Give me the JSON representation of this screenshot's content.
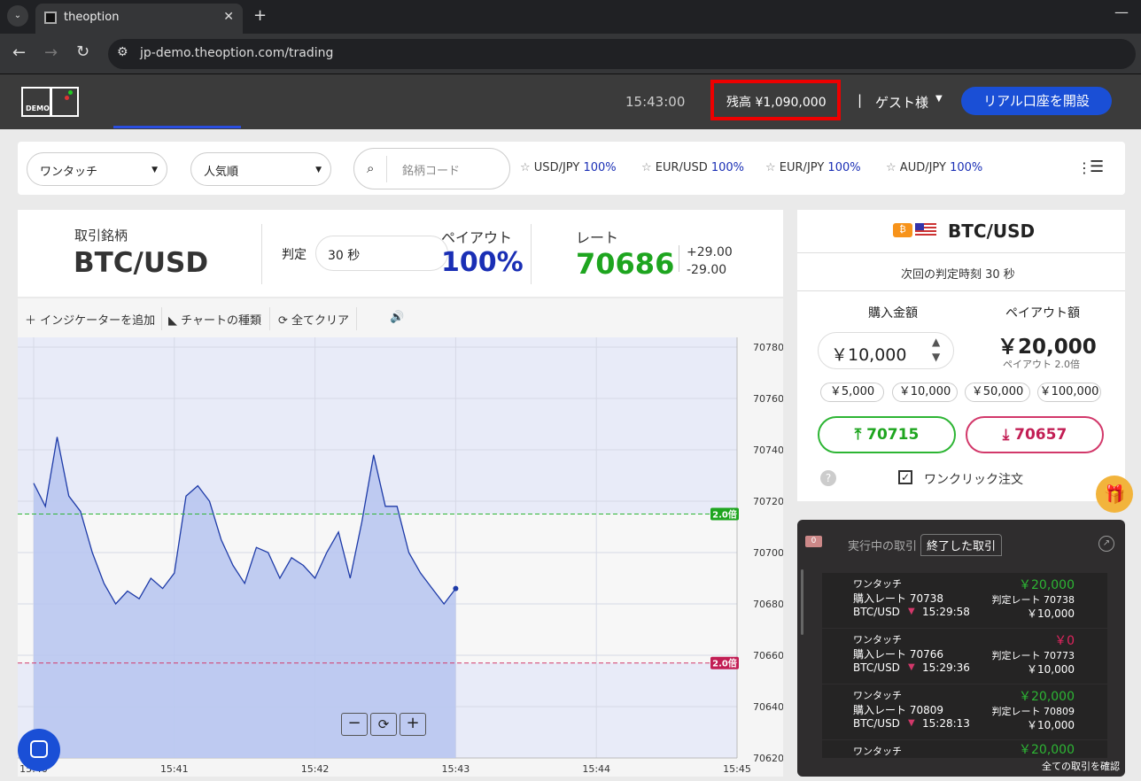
{
  "browser": {
    "tab_title": "theoption",
    "url": "jp-demo.theoption.com/trading"
  },
  "header": {
    "logo_text": "DEMO",
    "time": "15:43:00",
    "balance": "残高 ¥1,090,000",
    "user": "ゲスト様",
    "open_account": "リアル口座を開設"
  },
  "toolbar": {
    "select_type": "ワンタッチ",
    "select_sort": "人気順",
    "search_placeholder": "銘柄コード",
    "favorites": [
      {
        "pair": "USD/JPY",
        "payout": "100%"
      },
      {
        "pair": "EUR/USD",
        "payout": "100%"
      },
      {
        "pair": "EUR/JPY",
        "payout": "100%"
      },
      {
        "pair": "AUD/JPY",
        "payout": "100%"
      }
    ]
  },
  "instrument": {
    "label": "取引銘柄",
    "symbol": "BTC/USD",
    "judge_label": "判定",
    "judge_value": "30 秒",
    "payout_label": "ペイアウト",
    "payout_value": "100%",
    "rate_label": "レート",
    "rate_value": "70686",
    "delta_up": "+29.00",
    "delta_down": "-29.00"
  },
  "chart_tools": {
    "add_indicator": "インジケーターを追加",
    "chart_type": "チャートの種類",
    "clear_all": "全てクリア"
  },
  "chart_data": {
    "type": "area",
    "x_ticks": [
      "15:40",
      "15:41",
      "15:42",
      "15:43",
      "15:44",
      "15:45"
    ],
    "y_ticks": [
      70780,
      70760,
      70740,
      70720,
      70700,
      70680,
      70660,
      70640,
      70620
    ],
    "ylim": [
      70620,
      70780
    ],
    "upper_line": {
      "value": 70715,
      "label": "2.0倍"
    },
    "lower_line": {
      "value": 70657,
      "label": "2.0倍"
    },
    "series": [
      {
        "x": [
          "15:40:00",
          "15:40:05",
          "15:40:10",
          "15:40:15",
          "15:40:20",
          "15:40:25",
          "15:40:30",
          "15:40:35",
          "15:40:40",
          "15:40:45",
          "15:40:50",
          "15:40:55",
          "15:41:00",
          "15:41:05",
          "15:41:10",
          "15:41:15",
          "15:41:20",
          "15:41:25",
          "15:41:30",
          "15:41:35",
          "15:41:40",
          "15:41:45",
          "15:41:50",
          "15:41:55",
          "15:42:00",
          "15:42:05",
          "15:42:10",
          "15:42:15",
          "15:42:20",
          "15:42:25",
          "15:42:30",
          "15:42:35",
          "15:42:40",
          "15:42:45",
          "15:42:50",
          "15:42:55",
          "15:43:00"
        ],
        "y": [
          70727,
          70718,
          70745,
          70722,
          70716,
          70700,
          70688,
          70680,
          70685,
          70682,
          70690,
          70686,
          70692,
          70722,
          70726,
          70720,
          70705,
          70695,
          70688,
          70702,
          70700,
          70690,
          70698,
          70695,
          70690,
          70700,
          70708,
          70690,
          70712,
          70738,
          70718,
          70718,
          70700,
          70692,
          70686,
          70680,
          70686
        ]
      }
    ]
  },
  "right_panel": {
    "symbol": "BTC/USD",
    "next_judge": "次回の判定時刻 30 秒",
    "purchase_label": "購入金額",
    "payout_label": "ペイアウト額",
    "amount": "￥10,000",
    "payout_amount": "￥20,000",
    "payout_multiplier": "ペイアウト 2.0倍",
    "chips": [
      "￥5,000",
      "￥10,000",
      "￥50,000",
      "￥100,000"
    ],
    "up_rate": "70715",
    "down_rate": "70657",
    "one_click": "ワンクリック注文"
  },
  "trades_panel": {
    "active_count": "0",
    "active_tab": "実行中の取引",
    "closed_tab": "終了した取引",
    "view_all": "全ての取引を確認",
    "items": [
      {
        "type": "ワンタッチ",
        "buy_rate": "購入レート 70738",
        "pair": "BTC/USD",
        "time": "15:29:58",
        "result": "￥20,000",
        "judge_rate": "判定レート 70738",
        "amount": "￥10,000",
        "win": true
      },
      {
        "type": "ワンタッチ",
        "buy_rate": "購入レート 70766",
        "pair": "BTC/USD",
        "time": "15:29:36",
        "result": "￥0",
        "judge_rate": "判定レート 70773",
        "amount": "￥10,000",
        "win": false
      },
      {
        "type": "ワンタッチ",
        "buy_rate": "購入レート 70809",
        "pair": "BTC/USD",
        "time": "15:28:13",
        "result": "￥20,000",
        "judge_rate": "判定レート 70809",
        "amount": "￥10,000",
        "win": true
      },
      {
        "type": "ワンタッチ",
        "result": "￥20,000",
        "win": true
      }
    ]
  },
  "colors": {
    "accent": "#1a4fd6",
    "up": "#1ea51f",
    "down": "#c21e54",
    "highlight": "#e00000"
  }
}
